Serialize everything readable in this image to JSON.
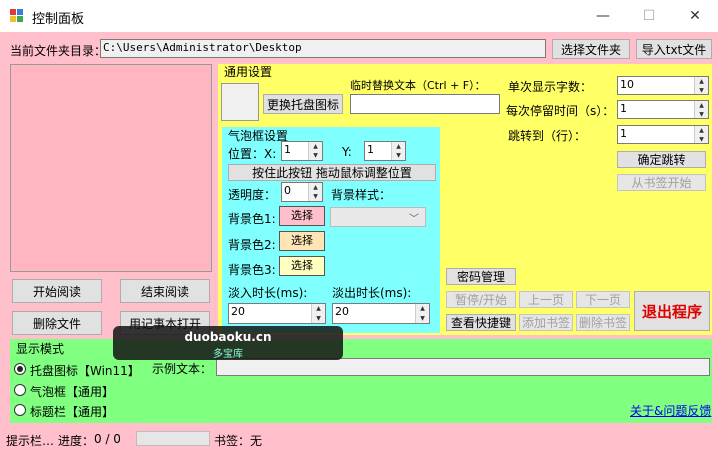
{
  "window": {
    "title": "控制面板",
    "minimize_glyph": "—",
    "maximize_glyph": "☐",
    "close_glyph": "✕",
    "icon_colors": [
      "#e03c31",
      "#3c7be0",
      "#f0c030",
      "#3caa4a"
    ]
  },
  "colors": {
    "main_bg": "#ffc0cb",
    "general_bg": "#ffff66",
    "bubble_bg": "#80ffff",
    "mode_bg": "#80ff80",
    "preview_bg": "#ffb6c1"
  },
  "folder": {
    "label": "当前文件夹目录：",
    "path": "C:\\Users\\Administrator\\Desktop",
    "choose_button": "选择文件夹",
    "import_button": "导入txt文件"
  },
  "left_buttons": {
    "start_reading": "开始阅读",
    "stop_reading": "结束阅读",
    "delete_file": "删除文件",
    "open_notepad": "用记事本打开"
  },
  "general": {
    "title": "通用设置",
    "change_tray_icon": "更换托盘图标",
    "temp_replace_label": "临时替换文本（Ctrl + F）：",
    "temp_replace_value": "",
    "chars_label": "单次显示字数：",
    "chars_value": "10",
    "interval_label": "每次停留时间（s）：",
    "interval_value": "1",
    "jump_label": "跳转到（行）：",
    "jump_value": "1",
    "confirm_jump": "确定跳转",
    "from_bookmark": "从书签开始",
    "password": "密码管理",
    "pause_start": "暂停/开始",
    "prev_page": "上一页",
    "next_page": "下一页",
    "exit": "退出程序",
    "shortcuts": "查看快捷键",
    "add_bookmark": "添加书签",
    "delete_bookmark": "删除书签"
  },
  "bubble": {
    "title": "气泡框设置",
    "position_label": "位置：X:",
    "x_value": "1",
    "y_label": "Y:",
    "y_value": "1",
    "drag_button": "按住此按钮  拖动鼠标调整位置",
    "opacity_label": "透明度：",
    "opacity_value": "0",
    "bg_style_label": "背景样式：",
    "bg_style_value": "",
    "bg1_label": "背景色1:",
    "bg1_button": "选择",
    "bg1_color": "#ffc0cb",
    "bg2_label": "背景色2:",
    "bg2_button": "选择",
    "bg2_color": "#ffe4b5",
    "bg3_label": "背景色3:",
    "bg3_button": "选择",
    "bg3_color": "#ffffc0",
    "fade_in_label": "淡入时长(ms):",
    "fade_in_value": "20",
    "fade_out_label": "淡出时长(ms):",
    "fade_out_value": "20"
  },
  "mode": {
    "title": "显示模式",
    "tray": "托盘图标【Win11】",
    "bubble": "气泡框【通用】",
    "titlebar": "标题栏【通用】",
    "sample_label": "示例文本：",
    "sample_value": "",
    "feedback_link": "关于&问题反馈"
  },
  "status": {
    "hint": "提示栏…",
    "progress_label": "进度：",
    "progress_text": "0 / 0",
    "progress_fraction": 0,
    "bookmark_label": "书签：",
    "bookmark_value": "无"
  },
  "watermark": {
    "site": "duobaoku.cn",
    "name": "多宝库"
  }
}
